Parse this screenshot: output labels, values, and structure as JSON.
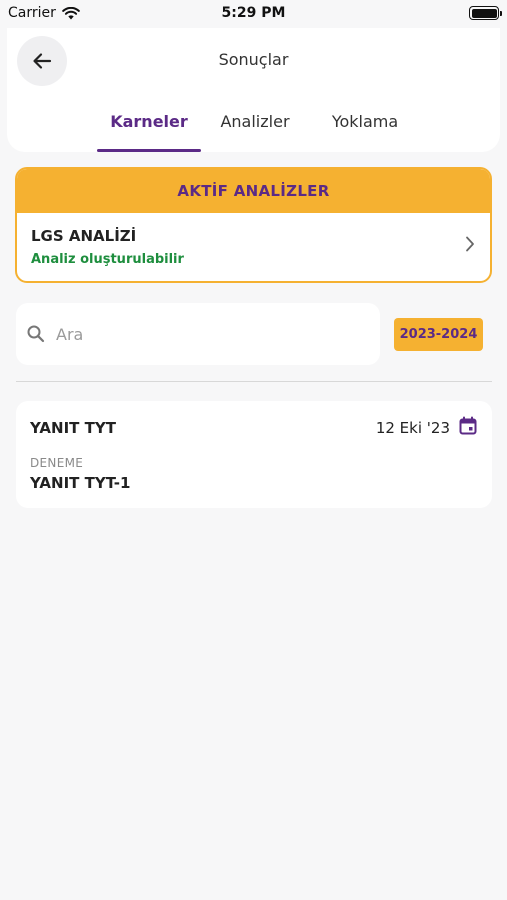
{
  "status_bar": {
    "carrier": "Carrier",
    "time": "5:29 PM"
  },
  "header": {
    "title": "Sonuçlar",
    "tabs": [
      {
        "label": "Karneler"
      },
      {
        "label": "Analizler"
      },
      {
        "label": "Yoklama"
      }
    ],
    "active_tab": "Karneler"
  },
  "active_analyses": {
    "heading": "AKTİF ANALİZLER",
    "items": [
      {
        "title": "LGS ANALİZİ",
        "status": "Analiz oluşturulabilir"
      }
    ]
  },
  "search": {
    "value": "",
    "placeholder": "Ara"
  },
  "year_filter": {
    "label": "2023-2024"
  },
  "results": [
    {
      "title": "YANIT TYT",
      "date": "12 Eki '23",
      "type": "DENEME",
      "name": "YANIT TYT-1"
    }
  ],
  "colors": {
    "accent": "#5b2a86",
    "highlight": "#f5b131",
    "success": "#1e8e3e"
  }
}
